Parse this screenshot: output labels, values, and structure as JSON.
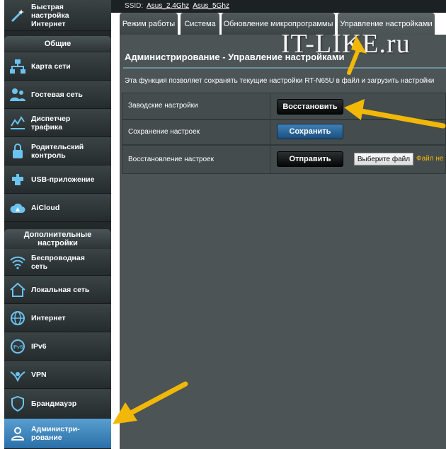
{
  "watermark": "IT-LIKE.ru",
  "quick_setup": "Быстрая настройка Интернет",
  "ssid": {
    "label": "SSID:",
    "band1": "Asus_2.4Ghz",
    "band2": "Asus_5Ghz"
  },
  "sidebar": {
    "general_header": "Общие",
    "general": [
      {
        "label": "Карта сети",
        "icon": "network-map-icon"
      },
      {
        "label": "Гостевая сеть",
        "icon": "guest-network-icon"
      },
      {
        "label": "Диспетчер трафика",
        "icon": "traffic-manager-icon"
      },
      {
        "label": "Родительский контроль",
        "icon": "parental-control-icon"
      },
      {
        "label": "USB-приложение",
        "icon": "usb-app-icon"
      },
      {
        "label": "AiCloud",
        "icon": "cloud-icon"
      }
    ],
    "advanced_header": "Дополнительные настройки",
    "advanced": [
      {
        "label": "Беспроводная сеть",
        "icon": "wireless-icon"
      },
      {
        "label": "Локальная сеть",
        "icon": "lan-home-icon"
      },
      {
        "label": "Интернет",
        "icon": "globe-icon"
      },
      {
        "label": "IPv6",
        "icon": "ipv6-icon"
      },
      {
        "label": "VPN",
        "icon": "vpn-icon"
      },
      {
        "label": "Брандмауэр",
        "icon": "firewall-icon"
      },
      {
        "label": "Администри-рование",
        "icon": "admin-user-icon"
      }
    ]
  },
  "tabs": [
    "Режим работы",
    "Система",
    "Обновление микропрограммы",
    "Управление настройками"
  ],
  "main": {
    "title": "Администрирование - Управление настройками",
    "description": "Эта функция позволяет сохранять текущие настройки RT-N65U в файл и загрузить настройки",
    "rows": [
      {
        "label": "Заводские настройки",
        "button": "Восстановить"
      },
      {
        "label": "Сохранение настроек",
        "button": "Сохранить"
      },
      {
        "label": "Восстановление настроек",
        "button": "Отправить",
        "file_button": "Выберите файл",
        "file_status": "Файл не"
      }
    ]
  },
  "colors": {
    "arrow": "#f2b807",
    "accent_blue": "#2a6fa8"
  }
}
